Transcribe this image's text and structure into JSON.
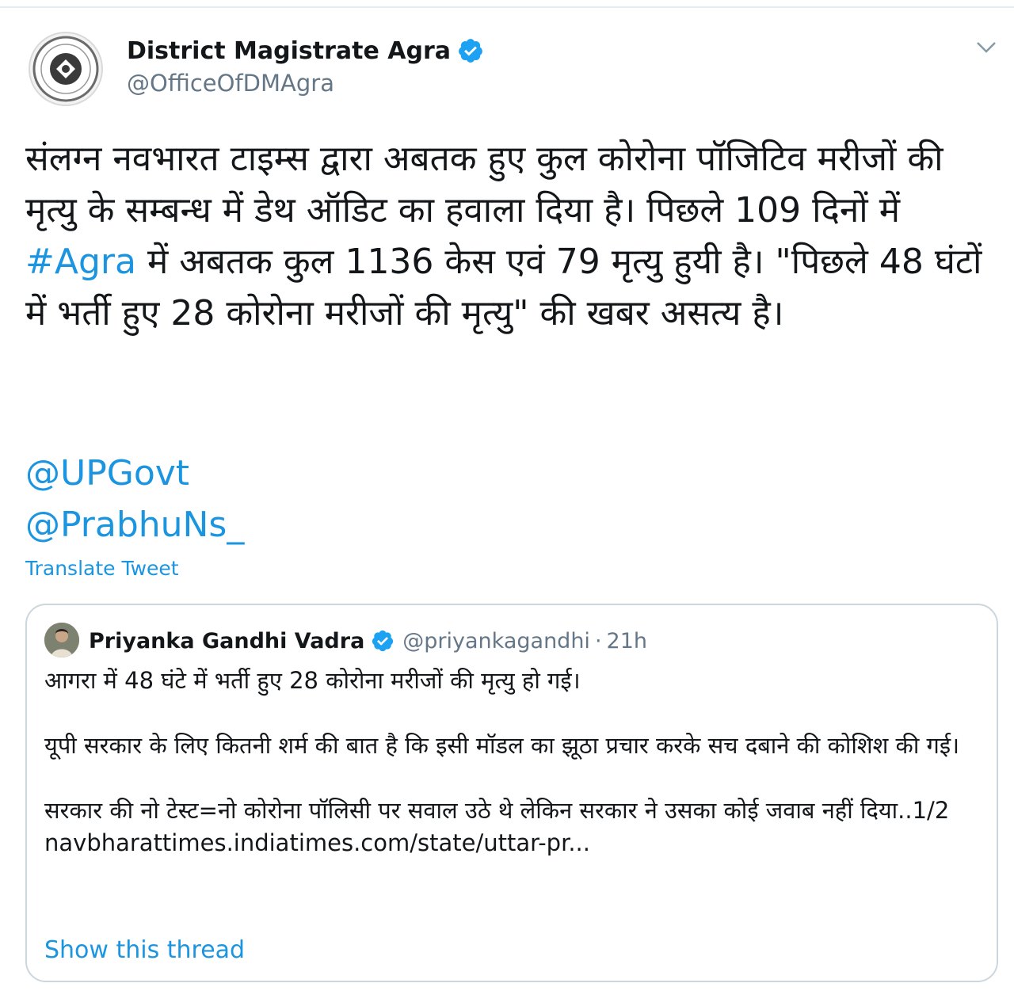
{
  "tweet": {
    "author": {
      "display_name": "District Magistrate Agra",
      "handle": "@OfficeOfDMAgra",
      "verified": true
    },
    "text": {
      "part1": "संलग्न नवभारत टाइम्स द्वारा अबतक हुए कुल कोरोना पॉजिटिव मरीजों की मृत्यु के सम्बन्ध में डेथ ऑडिट का हवाला दिया है। पिछले 109 दिनों में ",
      "hashtag": "#Agra",
      "part2": " में अबतक कुल 1136 केस एवं 79 मृत्यु हुयी है। \"पिछले 48 घंटों में भर्ती हुए 28 कोरोना मरीजों की मृत्यु\" की खबर असत्य है।"
    },
    "mentions": [
      "@UPGovt",
      "@PrabhuNs_"
    ],
    "translate_label": "Translate Tweet"
  },
  "quoted_tweet": {
    "author": {
      "display_name": "Priyanka Gandhi Vadra",
      "handle": "@priyankagandhi",
      "verified": true
    },
    "separator": "·",
    "time": "21h",
    "paragraphs": [
      "आगरा में 48 घंटे में भर्ती हुए 28 कोरोना मरीजों की मृत्यु हो गई।",
      "यूपी सरकार के लिए कितनी शर्म की बात है कि इसी मॉडल का झूठा प्रचार करके सच दबाने की कोशिश की गई।",
      "सरकार की नो टेस्ट=नो कोरोना पॉलिसी पर सवाल उठे थे लेकिन सरकार ने उसका कोई जवाब नहीं दिया..1/2"
    ],
    "link": "navbharattimes.indiatimes.com/state/uttar-pr...",
    "show_thread_label": "Show this thread"
  },
  "colors": {
    "accent": "#1b95e0",
    "verified_badge": "#1da1f2",
    "text": "#14171a",
    "secondary_text": "#657786",
    "border": "#ccd6dd"
  },
  "icons": {
    "verified": "verified-badge-icon",
    "caret": "chevron-down-icon",
    "avatar": "emblem-seal-icon"
  }
}
